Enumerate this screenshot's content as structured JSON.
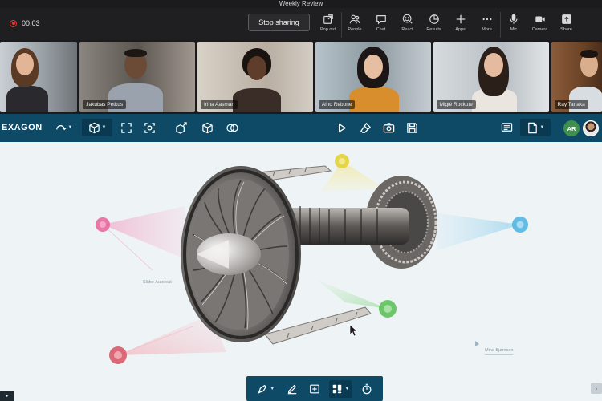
{
  "meeting": {
    "title": "Weekly Review",
    "timer": "00:03",
    "stop_sharing_label": "Stop sharing",
    "tools": [
      {
        "label": "Pop out",
        "icon": "pop-out-icon"
      },
      {
        "label": "People",
        "icon": "people-icon"
      },
      {
        "label": "Chat",
        "icon": "chat-icon"
      },
      {
        "label": "React",
        "icon": "react-icon"
      },
      {
        "label": "Results",
        "icon": "results-icon"
      },
      {
        "label": "Apps",
        "icon": "apps-icon"
      },
      {
        "label": "More",
        "icon": "more-icon"
      },
      {
        "label": "Mic",
        "icon": "mic-icon"
      },
      {
        "label": "Camera",
        "icon": "camera-icon"
      },
      {
        "label": "Share",
        "icon": "share-icon"
      }
    ]
  },
  "participants": [
    {
      "name": "",
      "bg": "#8a8f94"
    },
    {
      "name": "Jakubas Petkus",
      "bg": "#6f6a66"
    },
    {
      "name": "Irina Aasman",
      "bg": "#bfb7ae"
    },
    {
      "name": "Aino Rebone",
      "bg": "#9aa7ae"
    },
    {
      "name": "Miglė Rockute",
      "bg": "#b8c0c6"
    },
    {
      "name": "Ray Tanaka",
      "bg": "#7a5a3c"
    }
  ],
  "app": {
    "brand": "EXAGON",
    "accent": "#0e4a66",
    "user_initials": "AR"
  },
  "canvas": {
    "annotations": [
      "Slider Autofeat",
      "Mina Bjørnsen"
    ]
  },
  "colors": {
    "pink": "#e8609a",
    "yellow": "#e3d23a",
    "blue": "#52b6e2",
    "green": "#5cc25a",
    "red": "#d95a6a"
  }
}
